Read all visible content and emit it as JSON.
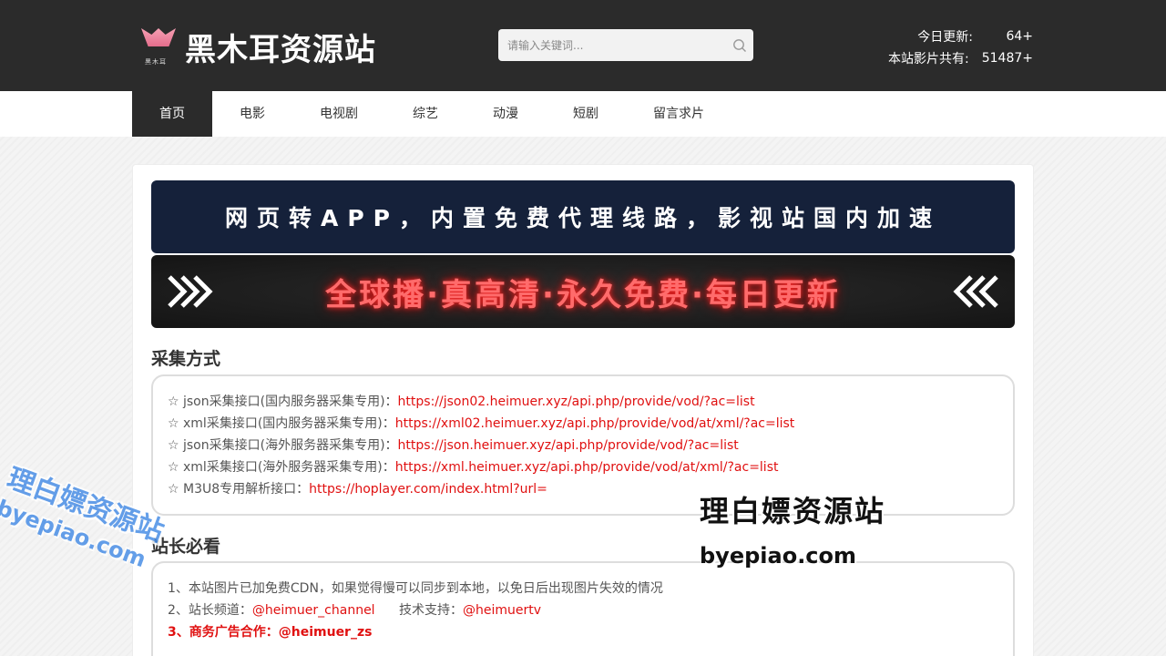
{
  "header": {
    "logo_sub": "黑木耳",
    "logo_text": "黑木耳资源站",
    "search_placeholder": "请输入关键词...",
    "stats": [
      {
        "label": "今日更新:",
        "value": "64+"
      },
      {
        "label": "本站影片共有:",
        "value": "51487+"
      }
    ]
  },
  "nav": {
    "items": [
      "首页",
      "电影",
      "电视剧",
      "综艺",
      "动漫",
      "短剧",
      "留言求片"
    ],
    "active_index": 0
  },
  "banners": {
    "top": "网页转APP，内置免费代理线路，影视站国内加速",
    "bottom": "全球播·真高清·永久免费·每日更新"
  },
  "collect": {
    "title": "采集方式",
    "items": [
      {
        "label": "☆ json采集接口(国内服务器采集专用)：",
        "url": "https://json02.heimuer.xyz/api.php/provide/vod/?ac=list"
      },
      {
        "label": "☆ xml采集接口(国内服务器采集专用)：",
        "url": "https://xml02.heimuer.xyz/api.php/provide/vod/at/xml/?ac=list"
      },
      {
        "label": "☆ json采集接口(海外服务器采集专用)：",
        "url": "https://json.heimuer.xyz/api.php/provide/vod/?ac=list"
      },
      {
        "label": "☆ xml采集接口(海外服务器采集专用)：",
        "url": "https://xml.heimuer.xyz/api.php/provide/vod/at/xml/?ac=list"
      },
      {
        "label": "☆ M3U8专用解析接口：",
        "url": "https://hoplayer.com/index.html?url="
      }
    ]
  },
  "notice": {
    "title": "站长必看",
    "line1": "1、本站图片已加免费CDN，如果觉得慢可以同步到本地，以免日后出现图片失效的情况",
    "line2_label": "2、站长频道：",
    "line2_channel": "@heimuer_channel",
    "line2_support_label": "技术支持：",
    "line2_support": "@heimuertv",
    "line3_label": "3、商务广告合作：",
    "line3_contact": "@heimuer_zs"
  },
  "watermarks": {
    "left_cn": "理白嫖资源站",
    "left_en": "byepiao.com",
    "right_cn": "理白嫖资源站",
    "right_en": "byepiao.com"
  },
  "colors": {
    "header_bg": "#2b2b2b",
    "link_red": "#e01010",
    "banner_navy": "#15213a",
    "neon_red": "#ff6b6b"
  }
}
